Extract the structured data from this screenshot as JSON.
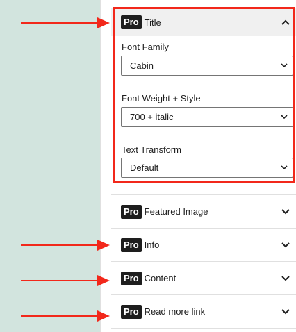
{
  "badge": "Pro",
  "title_section": {
    "label": "Title",
    "chevron": "▲",
    "font_family": {
      "label": "Font Family",
      "value": "Cabin"
    },
    "font_weight_style": {
      "label": "Font Weight + Style",
      "value": "700 + italic"
    },
    "text_transform": {
      "label": "Text Transform",
      "value": "Default"
    }
  },
  "collapsed_sections": [
    {
      "label": "Featured Image"
    },
    {
      "label": "Info"
    },
    {
      "label": "Content"
    },
    {
      "label": "Read more link"
    }
  ],
  "icons": {
    "expanded": "chevron-up-icon",
    "collapsed": "chevron-down-icon"
  },
  "colors": {
    "annotation": "#f2281b",
    "canvas": "#d2e4de",
    "badge": "#1e1e1e"
  }
}
